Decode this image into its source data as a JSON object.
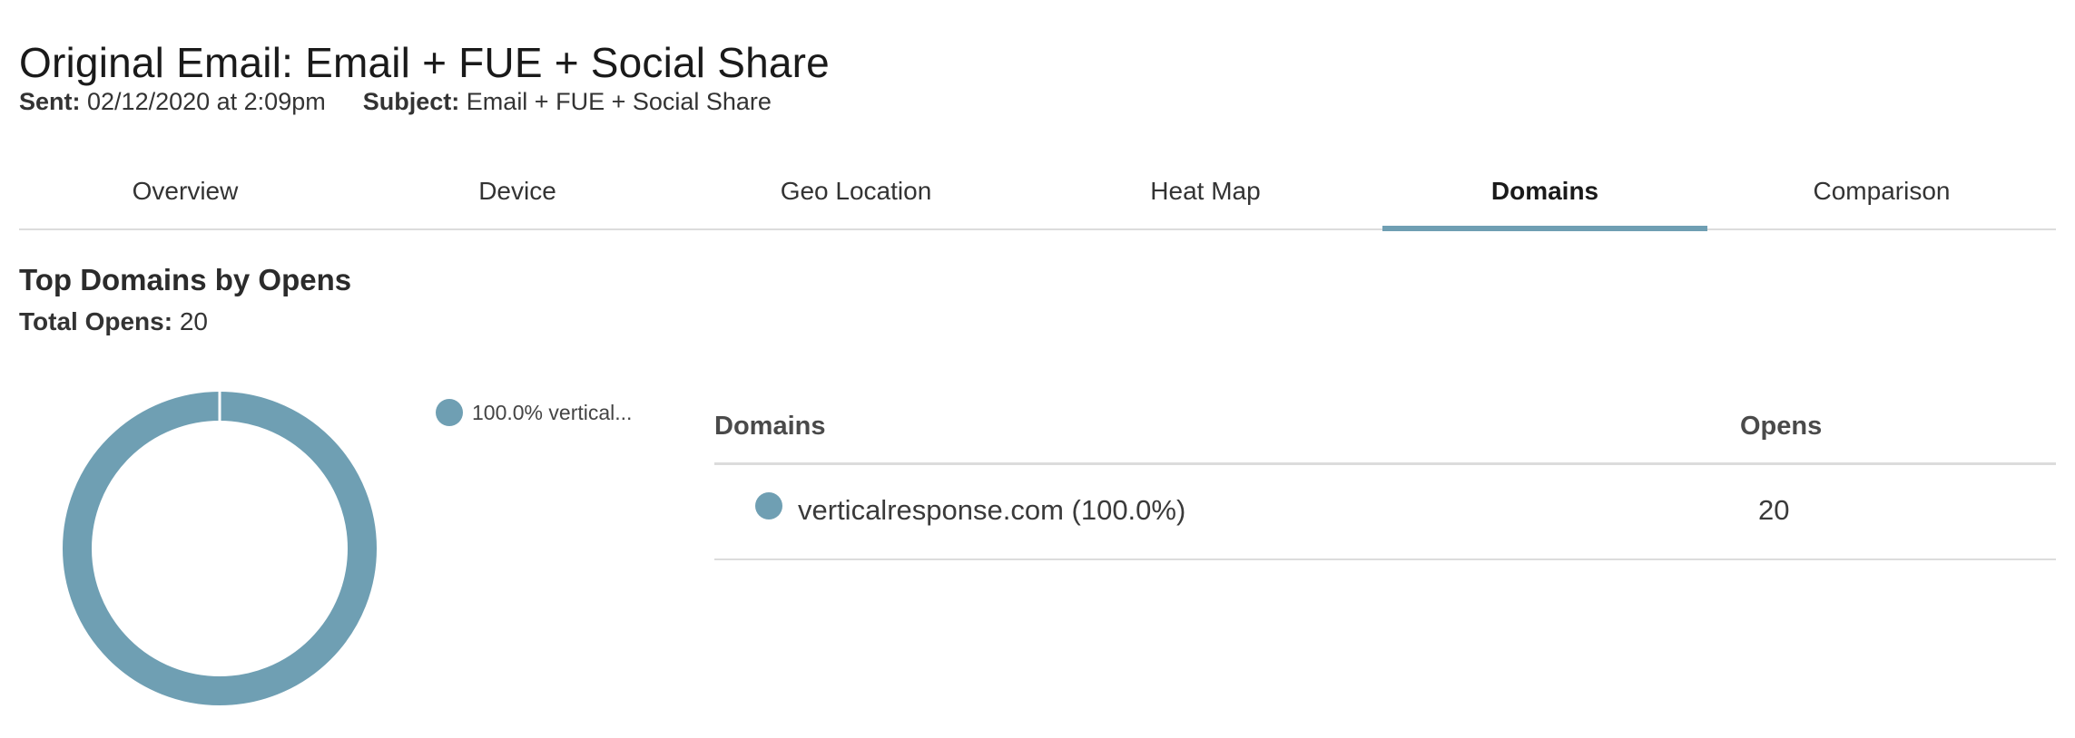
{
  "header": {
    "title": "Original Email: Email + FUE + Social Share",
    "sent_label": "Sent:",
    "sent_value": "02/12/2020 at 2:09pm",
    "subject_label": "Subject:",
    "subject_value": "Email + FUE + Social Share"
  },
  "tabs": [
    {
      "label": "Overview",
      "active": false
    },
    {
      "label": "Device",
      "active": false
    },
    {
      "label": "Geo Location",
      "active": false
    },
    {
      "label": "Heat Map",
      "active": false
    },
    {
      "label": "Domains",
      "active": true
    },
    {
      "label": "Comparison",
      "active": false
    }
  ],
  "section": {
    "title": "Top Domains by Opens",
    "total_label": "Total Opens:",
    "total_value": "20"
  },
  "chart_data": {
    "type": "pie",
    "variant": "donut",
    "categories": [
      "verticalresponse.com"
    ],
    "values": [
      20
    ],
    "colors": [
      "#6f9fb3"
    ],
    "legend": [
      "100.0% vertical..."
    ],
    "legend_position": "right"
  },
  "legend": {
    "label": "100.0% vertical..."
  },
  "table": {
    "headers": {
      "domains": "Domains",
      "opens": "Opens"
    },
    "rows": [
      {
        "domain": "verticalresponse.com (100.0%)",
        "opens": "20",
        "color": "#6f9fb3"
      }
    ]
  },
  "colors": {
    "accent": "#6f9fb3",
    "divider": "#dcdcdc"
  }
}
